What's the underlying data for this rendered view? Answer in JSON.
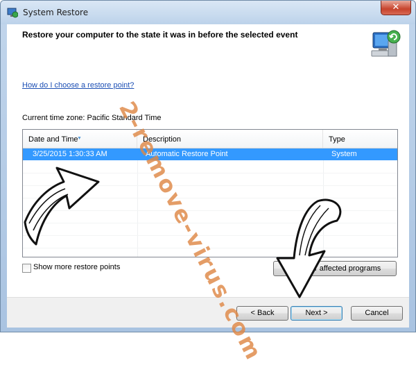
{
  "window": {
    "title": "System Restore",
    "close_glyph": "✕"
  },
  "header": {
    "title": "Restore your computer to the state it was in before the selected event",
    "icon": "system-restore-icon"
  },
  "content": {
    "help_link": "How do I choose a restore point?",
    "timezone": "Current time zone: Pacific Standard Time",
    "columns": [
      "Date and Time",
      "Description",
      "Type"
    ],
    "rows": [
      {
        "date": "3/25/2015 1:30:33 AM",
        "description": "Automatic Restore Point",
        "type": "System",
        "selected": true
      }
    ],
    "show_more_label": "Show more restore points",
    "show_more_checked": false,
    "scan_button": "Scan for affected programs"
  },
  "footer": {
    "back": "< Back",
    "next": "Next >",
    "cancel": "Cancel"
  },
  "watermark": "2-remove-virus.com",
  "colors": {
    "selection": "#3399ff",
    "link": "#1c4fb4",
    "watermark": "#de8746"
  }
}
